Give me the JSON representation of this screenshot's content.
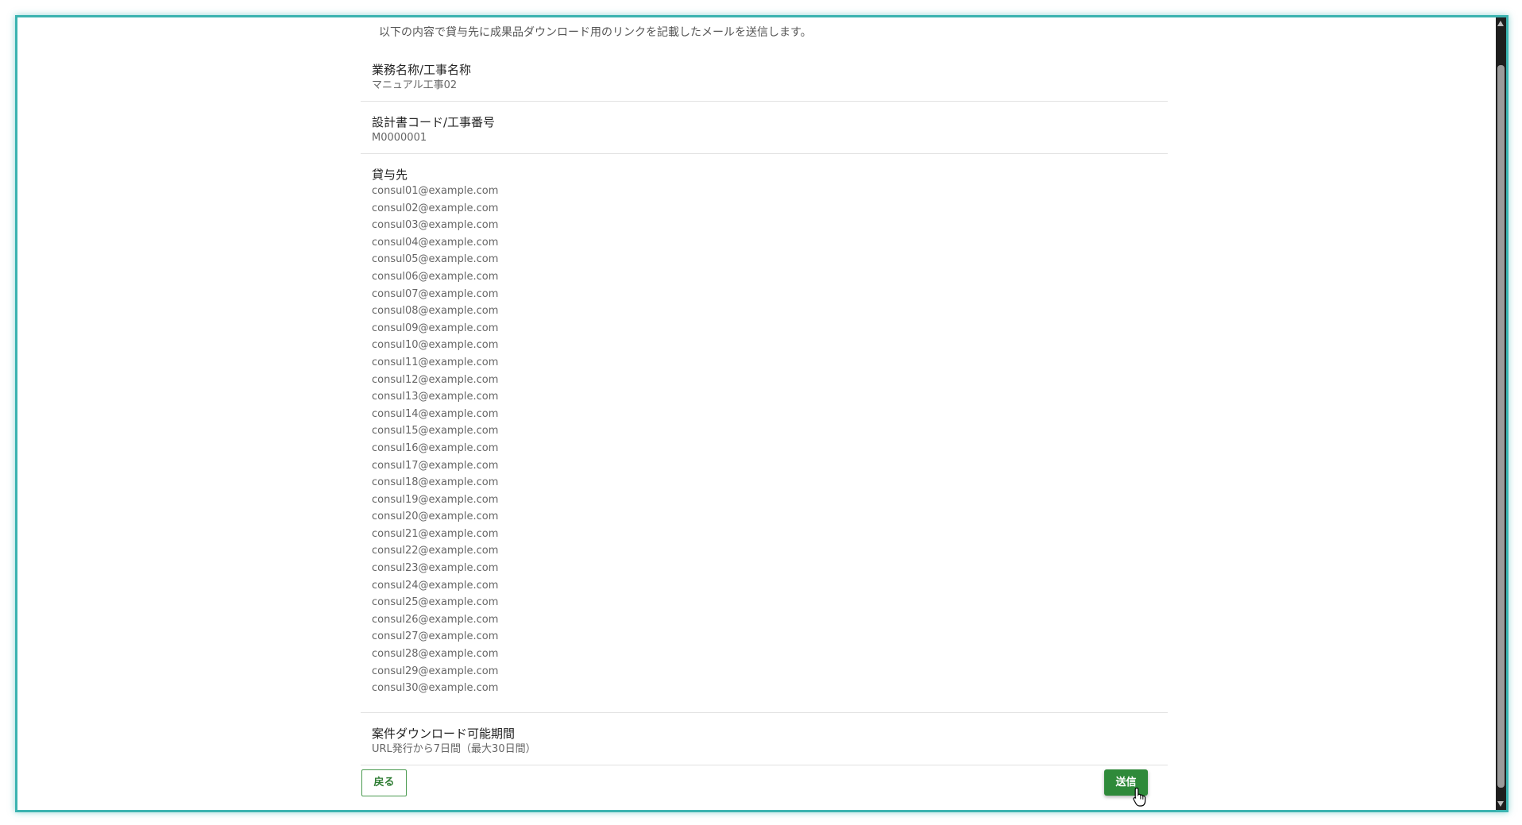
{
  "intro_text": "以下の内容で貸与先に成果品ダウンロード用のリンクを記載したメールを送信します。",
  "sections": {
    "work_name": {
      "label": "業務名称/工事名称",
      "value": "マニュアル工事02"
    },
    "design_code": {
      "label": "設計書コード/工事番号",
      "value": "M0000001"
    },
    "lenders": {
      "label": "貸与先",
      "emails": [
        "consul01@example.com",
        "consul02@example.com",
        "consul03@example.com",
        "consul04@example.com",
        "consul05@example.com",
        "consul06@example.com",
        "consul07@example.com",
        "consul08@example.com",
        "consul09@example.com",
        "consul10@example.com",
        "consul11@example.com",
        "consul12@example.com",
        "consul13@example.com",
        "consul14@example.com",
        "consul15@example.com",
        "consul16@example.com",
        "consul17@example.com",
        "consul18@example.com",
        "consul19@example.com",
        "consul20@example.com",
        "consul21@example.com",
        "consul22@example.com",
        "consul23@example.com",
        "consul24@example.com",
        "consul25@example.com",
        "consul26@example.com",
        "consul27@example.com",
        "consul28@example.com",
        "consul29@example.com",
        "consul30@example.com"
      ]
    },
    "download_period": {
      "label": "案件ダウンロード可能期間",
      "value": "URL発行から7日間（最大30日間）"
    }
  },
  "buttons": {
    "back_label": "戻る",
    "send_label": "送信"
  },
  "icons": {
    "cursor": "hand-pointer-icon"
  },
  "colors": {
    "accent": "#2f8a3a",
    "frame": "#3bb3b0"
  }
}
